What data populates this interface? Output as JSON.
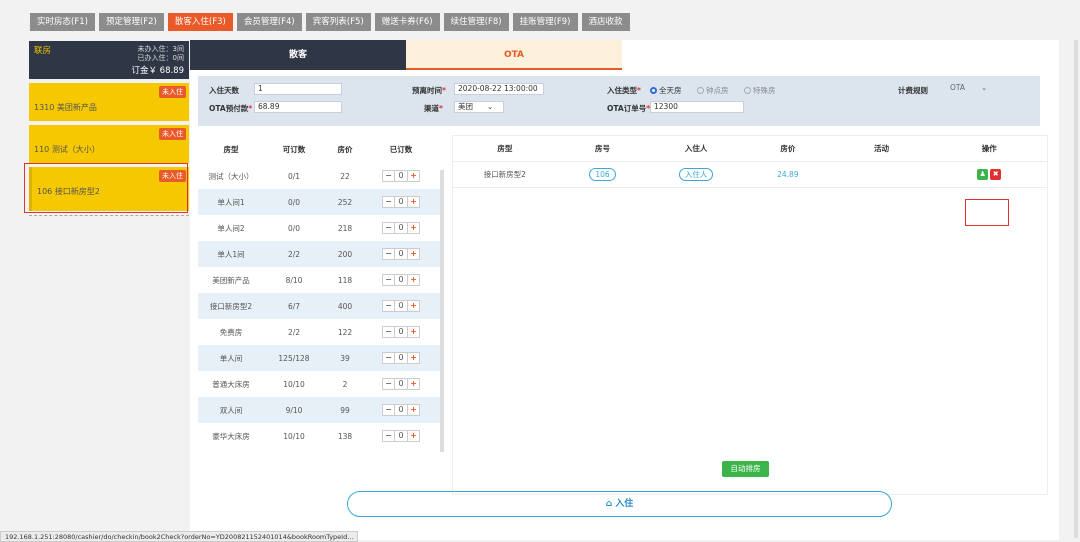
{
  "nav_tabs": [
    "实时房态(F1)",
    "预定管理(F2)",
    "散客入住(F3)",
    "会员管理(F4)",
    "宾客列表(F5)",
    "赠送卡券(F6)",
    "续住管理(F8)",
    "挂账管理(F9)",
    "酒店收款"
  ],
  "active_tab": 2,
  "sidebar": {
    "group": {
      "title": "联房",
      "not_checked": "未办入住：3间",
      "checked": "已办入住：0间",
      "deposit": "订金￥ 68.89"
    },
    "rooms": [
      {
        "badge": "未入住",
        "name": "1310 美团新产品"
      },
      {
        "badge": "未入住",
        "name": "110 测试（大小）"
      },
      {
        "badge": "未入住",
        "name": "106 接口新房型2"
      }
    ]
  },
  "panel_tabs": [
    "散客",
    "OTA"
  ],
  "form": {
    "days_label": "入住天数",
    "days_value": "1",
    "prepaid_label": "OTA预付款",
    "prepaid_value": "68.89",
    "leave_label": "预离时间",
    "leave_value": "2020-08-22 13:00:00",
    "channel_label": "渠道",
    "channel_value": "美团",
    "type_label": "入住类型",
    "type_opts": [
      "全天房",
      "钟点房",
      "特殊房"
    ],
    "order_label": "OTA订单号",
    "order_value": "12300",
    "rule_label": "计费规则",
    "rule_value": "OTA",
    "required": "*"
  },
  "left_table": {
    "headers": [
      "房型",
      "可订数",
      "房价",
      "已订数"
    ],
    "rows": [
      [
        "测试（大小）",
        "0/1",
        "22",
        "0"
      ],
      [
        "单人间1",
        "0/0",
        "252",
        "0"
      ],
      [
        "单人间2",
        "0/0",
        "218",
        "0"
      ],
      [
        "单人1间",
        "2/2",
        "200",
        "0"
      ],
      [
        "美团新产品",
        "8/10",
        "118",
        "0"
      ],
      [
        "接口新房型2",
        "6/7",
        "400",
        "0"
      ],
      [
        "免费房",
        "2/2",
        "122",
        "0"
      ],
      [
        "单人间",
        "125/128",
        "39",
        "0"
      ],
      [
        "普通大床房",
        "10/10",
        "2",
        "0"
      ],
      [
        "双人间",
        "9/10",
        "99",
        "0"
      ],
      [
        "豪华大床房",
        "10/10",
        "138",
        "0"
      ]
    ],
    "minus": "−",
    "plus": "+"
  },
  "right_table": {
    "headers": [
      "房型",
      "房号",
      "入住人",
      "房价",
      "活动",
      "操作"
    ],
    "row": {
      "type": "接口新房型2",
      "room": "106",
      "guest": "入住人",
      "price": "24.89",
      "activity": ""
    }
  },
  "auto_button": "自动排房",
  "checkin_button": "入住",
  "status_url": "192.168.1.251:28080/cashier/do/checkin/book2Check?orderNo=YD200821152401014&bookRoomTypeId..."
}
